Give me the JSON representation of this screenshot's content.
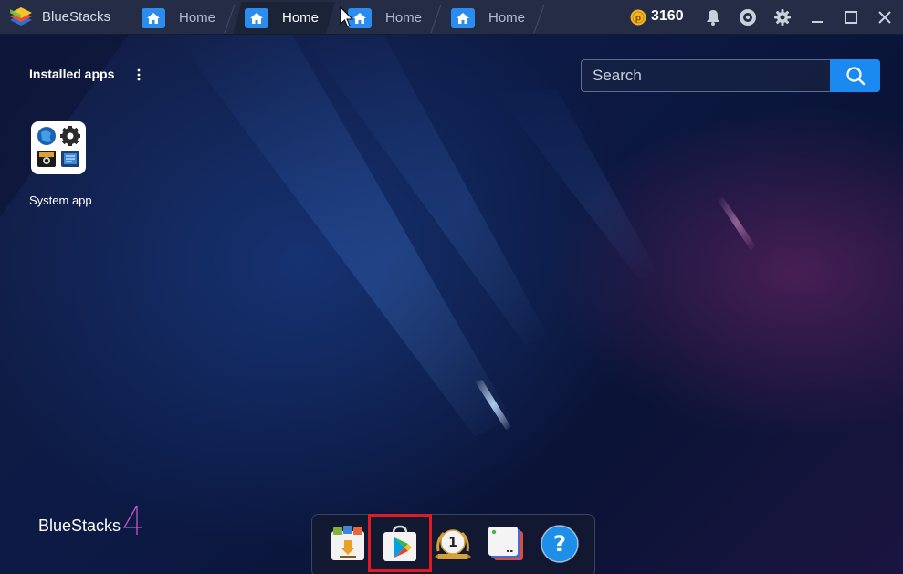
{
  "window": {
    "app_name": "BlueStacks",
    "coin_count": "3160",
    "tabs": [
      {
        "label": "Home",
        "active": false
      },
      {
        "label": "Home",
        "active": true
      },
      {
        "label": "Home",
        "active": false
      },
      {
        "label": "Home",
        "active": false
      }
    ],
    "toolbar_icons": [
      "bell-icon",
      "account-icon",
      "gear-icon",
      "minimize-icon",
      "maximize-icon",
      "close-icon"
    ]
  },
  "home": {
    "section_title": "Installed apps",
    "search": {
      "placeholder": "Search",
      "value": ""
    },
    "apps": [
      {
        "label": "System app"
      }
    ],
    "brand_text": "BlueStacks",
    "brand_version": "4"
  },
  "dock": {
    "items": [
      "install-apk-icon",
      "play-store-icon",
      "game-pop-icon",
      "multi-instance-icon",
      "help-icon"
    ],
    "highlighted": "play-store-icon"
  },
  "colors": {
    "accent": "#1a8af0",
    "titlebar": "#242d45",
    "highlight": "#e01b24"
  }
}
